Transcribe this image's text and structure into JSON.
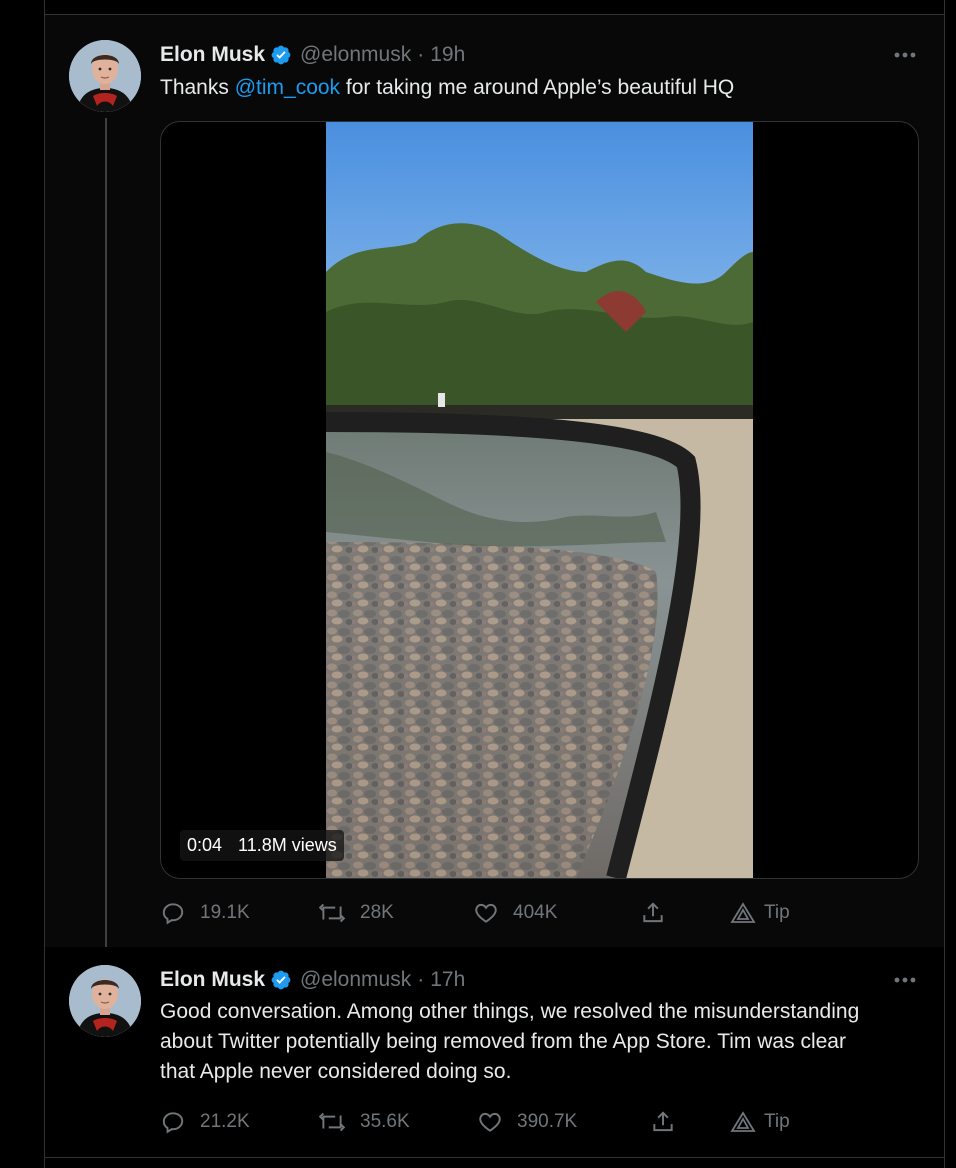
{
  "tweets": [
    {
      "name": "Elon Musk",
      "handle": "@elonmusk",
      "separator": "·",
      "time": "19h",
      "text_before": "Thanks ",
      "mention": "@tim_cook",
      "text_after": " for taking me around Apple’s beautiful HQ",
      "video": {
        "duration": "0:04",
        "views": "11.8M views"
      },
      "stats": {
        "replies": "19.1K",
        "retweets": "28K",
        "likes": "404K",
        "tip": "Tip"
      }
    },
    {
      "name": "Elon Musk",
      "handle": "@elonmusk",
      "separator": "·",
      "time": "17h",
      "text_lines": [
        "Good conversation. Among other things, we resolved the misunderstanding",
        "about Twitter potentially being removed from the App Store. Tim was clear",
        "that Apple never considered doing so."
      ],
      "stats": {
        "replies": "21.2K",
        "retweets": "35.6K",
        "likes": "390.7K",
        "tip": "Tip"
      }
    }
  ],
  "colors": {
    "accent": "#1d9bf0",
    "text": "#e7e9ea",
    "muted": "#71767b",
    "verified": "#1d9bf0"
  },
  "icons": [
    "verified-badge-icon",
    "more-icon",
    "reply-icon",
    "retweet-icon",
    "like-icon",
    "share-icon",
    "tip-icon"
  ]
}
